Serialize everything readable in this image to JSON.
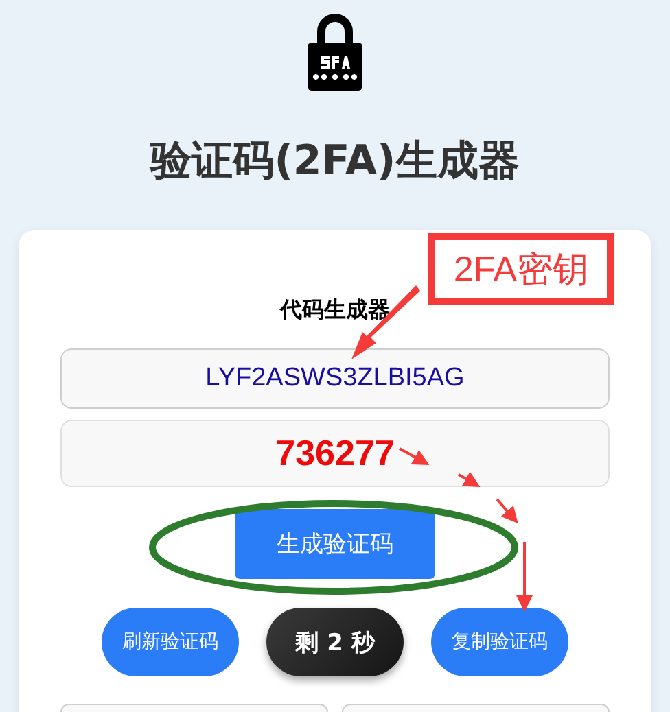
{
  "title": "验证码(2FA)生成器",
  "card": {
    "heading": "代码生成器",
    "secret_value": "LYF2ASWS3ZLBI5AG",
    "code_value": "736277",
    "generate_button": "生成验证码",
    "actions": [
      {
        "kind": "button",
        "label": "刷新验证码"
      },
      {
        "kind": "countdown",
        "label": "剩 2 秒"
      },
      {
        "kind": "button",
        "label": "复制验证码"
      }
    ]
  },
  "annotation": {
    "label": "2FA密钥"
  }
}
